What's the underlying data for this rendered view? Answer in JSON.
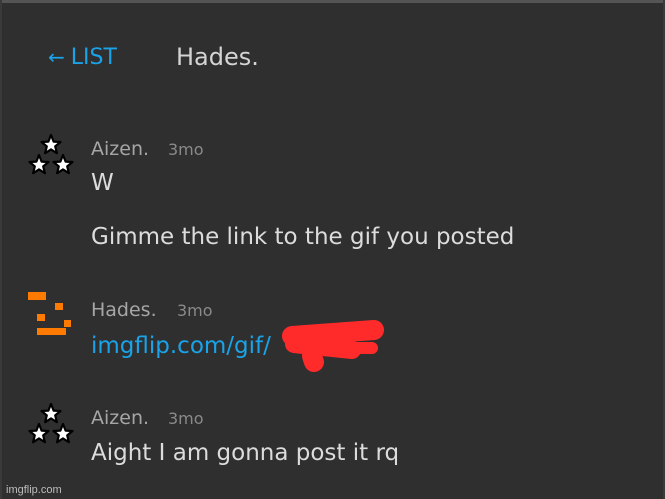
{
  "header": {
    "back_label": "LIST",
    "title": "Hades."
  },
  "messages": [
    {
      "author": "Aizen.",
      "time": "3mo",
      "avatar_icon": "three-stars-icon",
      "lines": [
        "W",
        "Gimme the link to the gif you posted"
      ]
    },
    {
      "author": "Hades.",
      "time": "3mo",
      "avatar_icon": "orange-pixel-face-icon",
      "link": "imgflip.com/gif/"
    },
    {
      "author": "Aizen.",
      "time": "3mo",
      "avatar_icon": "three-stars-icon",
      "lines": [
        "Aight I am gonna post it rq"
      ]
    }
  ],
  "watermark": "imgflip.com",
  "colors": {
    "background": "#2f2f2f",
    "accent_link": "#1aa3e8",
    "author": "#a6a6a6",
    "text": "#dcdcdc",
    "hades_avatar": "#ff7a00",
    "redaction": "#ff2b2b"
  }
}
